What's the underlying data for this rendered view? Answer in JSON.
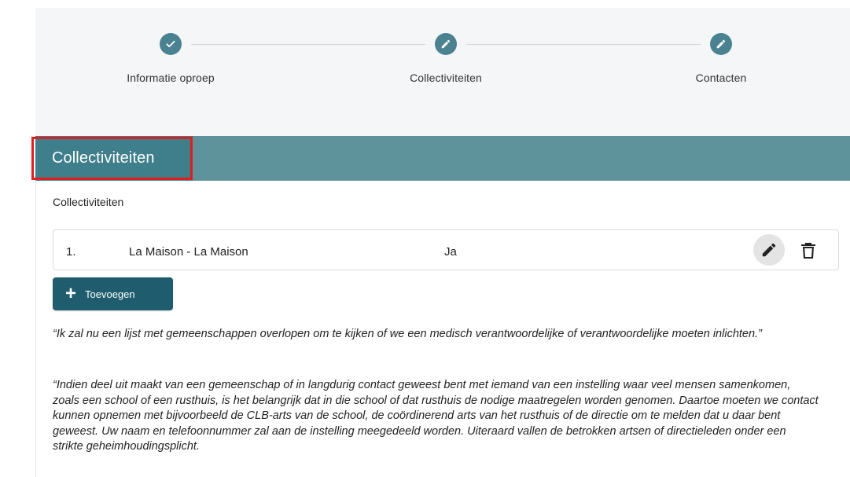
{
  "stepper": {
    "steps": [
      {
        "label": "Informatie oproep",
        "icon": "check-icon"
      },
      {
        "label": "Collectiviteiten",
        "icon": "pencil-icon"
      },
      {
        "label": "Contacten",
        "icon": "pencil-icon"
      }
    ]
  },
  "section": {
    "title": "Collectiviteiten",
    "subheading": "Collectiviteiten"
  },
  "list": {
    "items": [
      {
        "number": "1.",
        "name": "La Maison - La Maison",
        "value": "Ja"
      }
    ]
  },
  "add_button": {
    "label": "Toevoegen"
  },
  "quotes": {
    "q1": "“Ik zal nu een lijst met gemeenschappen overlopen om te kijken of we een medisch verantwoordelijke of verantwoordelijke moeten inlichten.”",
    "q2": "“Indien deel uit maakt van een gemeenschap of in langdurig contact geweest bent met iemand van een instelling waar veel mensen samenkomen, zoals een school of een rusthuis, is het belangrijk dat in die school of dat rusthuis de nodige maatregelen worden genomen. Daartoe moeten we contact kunnen opnemen met bijvoorbeeld de CLB-arts van de school, de coördinerend arts van het rusthuis of de directie om te melden dat u daar bent geweest. Uw naam en telefoonnummer zal aan de instelling meegedeeld worden. Uiteraard vallen de betrokken artsen of directieleden onder een strikte geheimhoudingsplicht."
  },
  "colors": {
    "step_circle": "#4a8291",
    "header_bar": "#5f939c",
    "header_title_bg": "#3e7f8b",
    "highlight": "#e21d1d",
    "button": "#1f5d6e"
  }
}
